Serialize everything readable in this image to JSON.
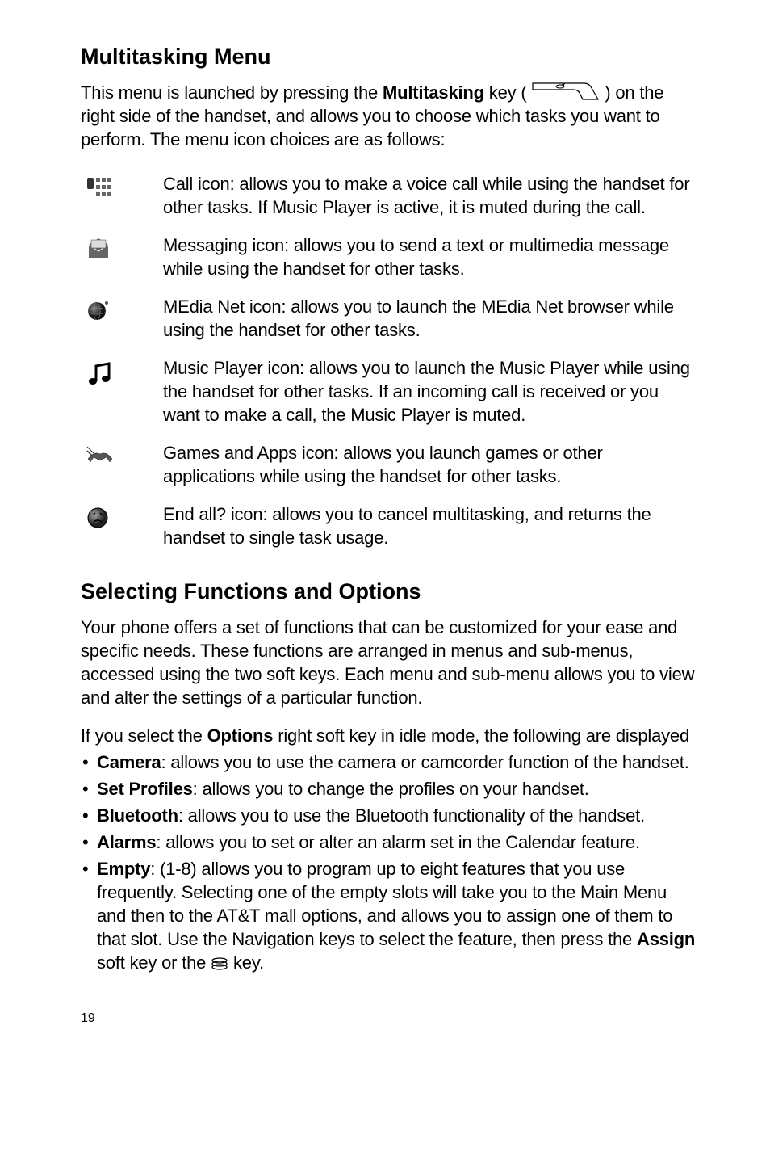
{
  "heading1": "Multitasking Menu",
  "intro_pre": "This menu is launched by pressing the ",
  "intro_bold1": "Multitasking",
  "intro_mid1": " key (",
  "intro_mid2": ") on the right side of the handset, and allows you to choose which tasks you want to perform. The menu icon choices are as follows:",
  "items": [
    "Call icon: allows you to make a voice call while using the handset for other tasks.  If Music Player is active, it is muted during the call.",
    "Messaging icon: allows you to send a text or multimedia message while using the handset for other tasks.",
    "MEdia Net icon: allows you to launch the MEdia Net browser while using the handset for other tasks.",
    "Music Player icon: allows you to launch the Music Player while using the handset for other tasks. If an incoming call  is received or you want to make a call, the Music Player is muted.",
    "Games and Apps icon: allows you launch games or other applications while using the handset for other tasks.",
    "End all? icon: allows you to cancel multitasking, and returns the handset to single task usage."
  ],
  "heading2": "Selecting Functions and Options",
  "para2": "Your phone offers a set of functions that can be customized for your ease and specific needs. These functions are arranged in menus and sub-menus, accessed using the two soft keys. Each menu and sub-menu allows you to view and alter the settings of a particular function.",
  "para3_pre": "If you select the ",
  "para3_bold": "Options",
  "para3_post": " right soft key in idle mode, the following are displayed",
  "bullets": [
    {
      "label": "Camera",
      "text": ": allows you to use the camera or camcorder function of the handset."
    },
    {
      "label": "Set Profiles",
      "text": ": allows you to change the profiles on your handset."
    },
    {
      "label": "Bluetooth",
      "text": ": allows you to use the Bluetooth functionality of the handset."
    },
    {
      "label": "Alarms",
      "text": ": allows you to set or alter an alarm set in the Calendar feature."
    }
  ],
  "bullet5_label": "Empty",
  "bullet5_pre": ": (1-8) allows you to program up to eight features that you use frequently. Selecting one of the empty slots will take you to the Main Menu and then to the AT&T mall options, and allows you to assign one of them to that slot. Use the Navigation keys to select the feature, then press the ",
  "bullet5_bold2": "Assign",
  "bullet5_mid": " soft key or the ",
  "bullet5_post": " key.",
  "page_number": "19"
}
